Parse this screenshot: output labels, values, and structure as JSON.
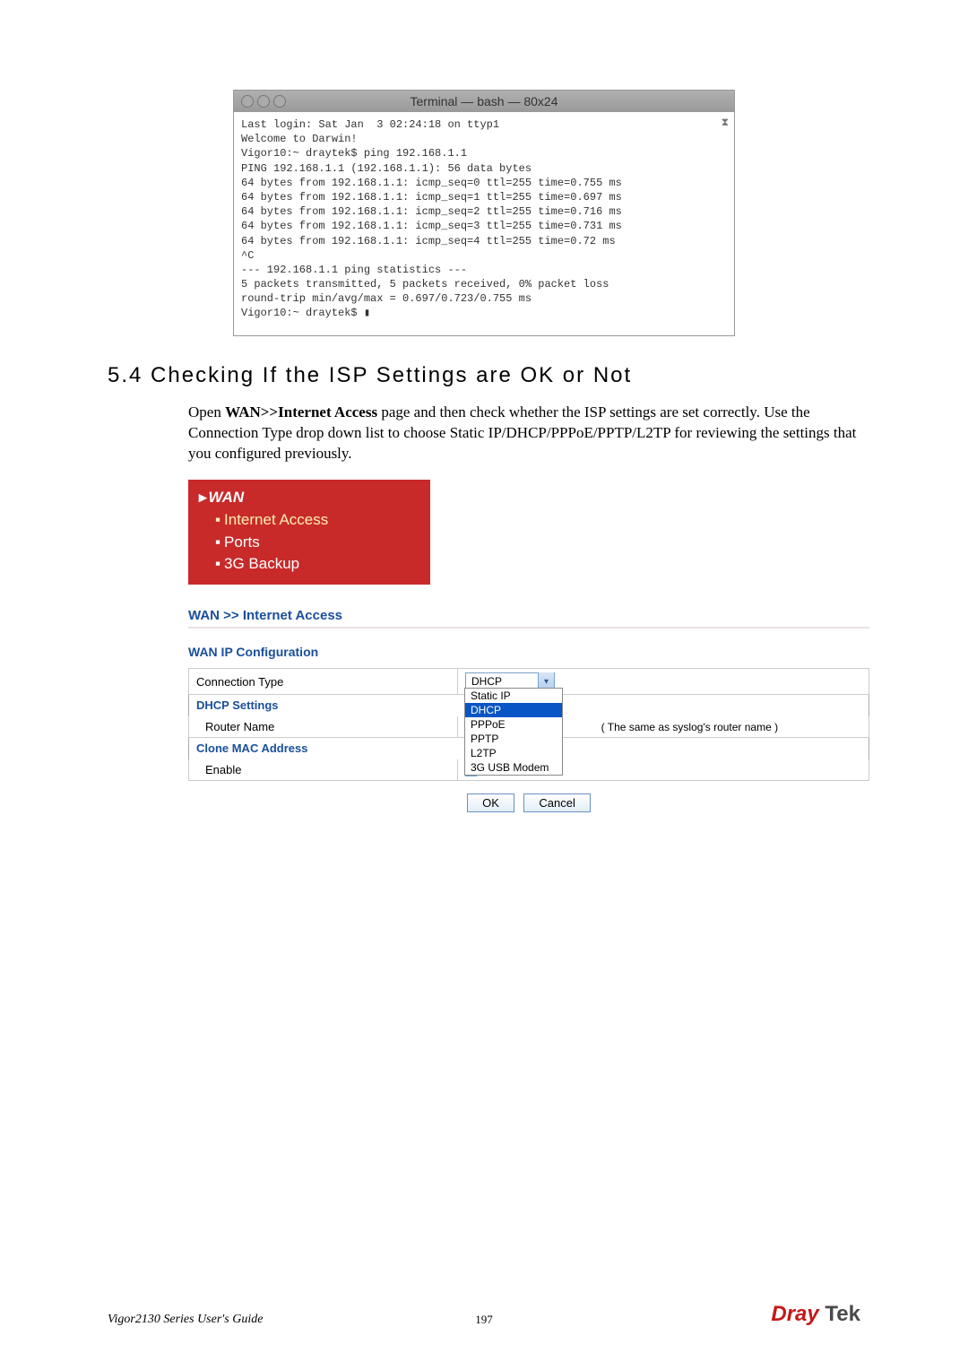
{
  "terminal": {
    "title": "Terminal — bash — 80x24",
    "lines": [
      "Last login: Sat Jan  3 02:24:18 on ttyp1",
      "Welcome to Darwin!",
      "Vigor10:~ draytek$ ping 192.168.1.1",
      "PING 192.168.1.1 (192.168.1.1): 56 data bytes",
      "64 bytes from 192.168.1.1: icmp_seq=0 ttl=255 time=0.755 ms",
      "64 bytes from 192.168.1.1: icmp_seq=1 ttl=255 time=0.697 ms",
      "64 bytes from 192.168.1.1: icmp_seq=2 ttl=255 time=0.716 ms",
      "64 bytes from 192.168.1.1: icmp_seq=3 ttl=255 time=0.731 ms",
      "64 bytes from 192.168.1.1: icmp_seq=4 ttl=255 time=0.72 ms",
      "^C",
      "--- 192.168.1.1 ping statistics ---",
      "5 packets transmitted, 5 packets received, 0% packet loss",
      "round-trip min/avg/max = 0.697/0.723/0.755 ms",
      "Vigor10:~ draytek$ ▮"
    ]
  },
  "section": {
    "number": "5.4",
    "title": "Checking If the ISP Settings are OK or Not"
  },
  "paragraph": {
    "prefix": "Open ",
    "bold": "WAN>>Internet Access",
    "rest": " page and then check whether the ISP settings are set correctly. Use the Connection Type drop down list to choose Static IP/DHCP/PPPoE/PPTP/L2TP for reviewing the settings that you configured previously."
  },
  "wanmenu": {
    "top": "WAN",
    "items": [
      "Internet Access",
      "Ports",
      "3G Backup"
    ]
  },
  "breadcrumb": "WAN >> Internet Access",
  "subhead": "WAN IP Configuration",
  "config": {
    "connection_type_label": "Connection Type",
    "connection_type_value": "DHCP",
    "options": [
      "Static IP",
      "DHCP",
      "PPPoE",
      "PPTP",
      "L2TP",
      "3G USB Modem"
    ],
    "dhcp_section": "DHCP Settings",
    "router_name_label": "Router Name",
    "router_name_value": "",
    "router_note": "( The same as syslog's router name )",
    "clone_section": "Clone MAC Address",
    "enable_label": "Enable"
  },
  "buttons": {
    "ok": "OK",
    "cancel": "Cancel"
  },
  "footer": {
    "left": "Vigor2130 Series User's Guide",
    "page": "197",
    "logo_a": "Dray",
    "logo_b": " Tek"
  }
}
